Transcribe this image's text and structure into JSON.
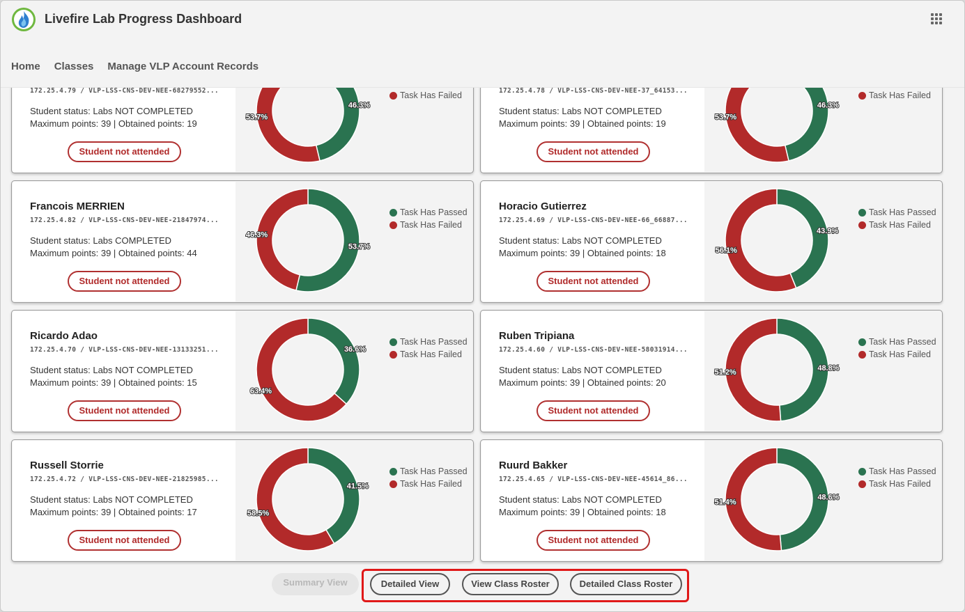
{
  "header": {
    "title": "Livefire Lab Progress Dashboard",
    "logo_icon": "flame-logo-icon",
    "apps_icon": "grid-apps-icon"
  },
  "nav": {
    "items": [
      "Home",
      "Classes",
      "Manage VLP Account Records"
    ]
  },
  "legend": {
    "passed": "Task Has Passed",
    "failed": "Task Has Failed",
    "passed_color": "#2a7350",
    "failed_color": "#b22a2a"
  },
  "students": [
    {
      "name": "",
      "ip": "172.25.4.79 / VLP-LSS-CNS-DEV-NEE-68279552...",
      "status": "Student status: Labs NOT COMPLETED",
      "points": "Maximum points: 39 | Obtained points: 19",
      "attendance": "Student not attended",
      "passed_pct": 46.3,
      "failed_pct": 53.7,
      "passed_label": "46.3%",
      "failed_label": "53.7%",
      "show_passed_legend": false
    },
    {
      "name": "",
      "ip": "172.25.4.78 / VLP-LSS-CNS-DEV-NEE-37_64153...",
      "status": "Student status: Labs NOT COMPLETED",
      "points": "Maximum points: 39 | Obtained points: 19",
      "attendance": "Student not attended",
      "passed_pct": 46.3,
      "failed_pct": 53.7,
      "passed_label": "46.3%",
      "failed_label": "53.7%",
      "show_passed_legend": false
    },
    {
      "name": "Francois MERRIEN",
      "ip": "172.25.4.82 / VLP-LSS-CNS-DEV-NEE-21847974...",
      "status": "Student status: Labs COMPLETED",
      "points": "Maximum points: 39 | Obtained points: 44",
      "attendance": "Student not attended",
      "passed_pct": 53.7,
      "failed_pct": 46.3,
      "passed_label": "53.7%",
      "failed_label": "46.3%",
      "show_passed_legend": true
    },
    {
      "name": "Horacio Gutierrez",
      "ip": "172.25.4.69 / VLP-LSS-CNS-DEV-NEE-66_66887...",
      "status": "Student status: Labs NOT COMPLETED",
      "points": "Maximum points: 39 | Obtained points: 18",
      "attendance": "Student not attended",
      "passed_pct": 43.9,
      "failed_pct": 56.1,
      "passed_label": "43.9%",
      "failed_label": "56.1%",
      "show_passed_legend": true
    },
    {
      "name": "Ricardo Adao",
      "ip": "172.25.4.70 / VLP-LSS-CNS-DEV-NEE-13133251...",
      "status": "Student status: Labs NOT COMPLETED",
      "points": "Maximum points: 39 | Obtained points: 15",
      "attendance": "Student not attended",
      "passed_pct": 36.6,
      "failed_pct": 63.4,
      "passed_label": "36.6%",
      "failed_label": "63.4%",
      "show_passed_legend": true
    },
    {
      "name": "Ruben Tripiana",
      "ip": "172.25.4.60 / VLP-LSS-CNS-DEV-NEE-58031914...",
      "status": "Student status: Labs NOT COMPLETED",
      "points": "Maximum points: 39 | Obtained points: 20",
      "attendance": "Student not attended",
      "passed_pct": 48.8,
      "failed_pct": 51.2,
      "passed_label": "48.8%",
      "failed_label": "51.2%",
      "show_passed_legend": true
    },
    {
      "name": "Russell Storrie",
      "ip": "172.25.4.72 / VLP-LSS-CNS-DEV-NEE-21825985...",
      "status": "Student status: Labs NOT COMPLETED",
      "points": "Maximum points: 39 | Obtained points: 17",
      "attendance": "Student not attended",
      "passed_pct": 41.5,
      "failed_pct": 58.5,
      "passed_label": "41.5%",
      "failed_label": "58.5%",
      "show_passed_legend": true
    },
    {
      "name": "Ruurd Bakker",
      "ip": "172.25.4.65 / VLP-LSS-CNS-DEV-NEE-45614_86...",
      "status": "Student status: Labs NOT COMPLETED",
      "points": "Maximum points: 39 | Obtained points: 18",
      "attendance": "Student not attended",
      "passed_pct": 48.6,
      "failed_pct": 51.4,
      "passed_label": "48.6%",
      "failed_label": "51.4%",
      "show_passed_legend": true
    }
  ],
  "footer": {
    "summary_view": "Summary View",
    "detailed_view": "Detailed View",
    "view_class_roster": "View Class Roster",
    "detailed_class_roster": "Detailed Class Roster"
  }
}
